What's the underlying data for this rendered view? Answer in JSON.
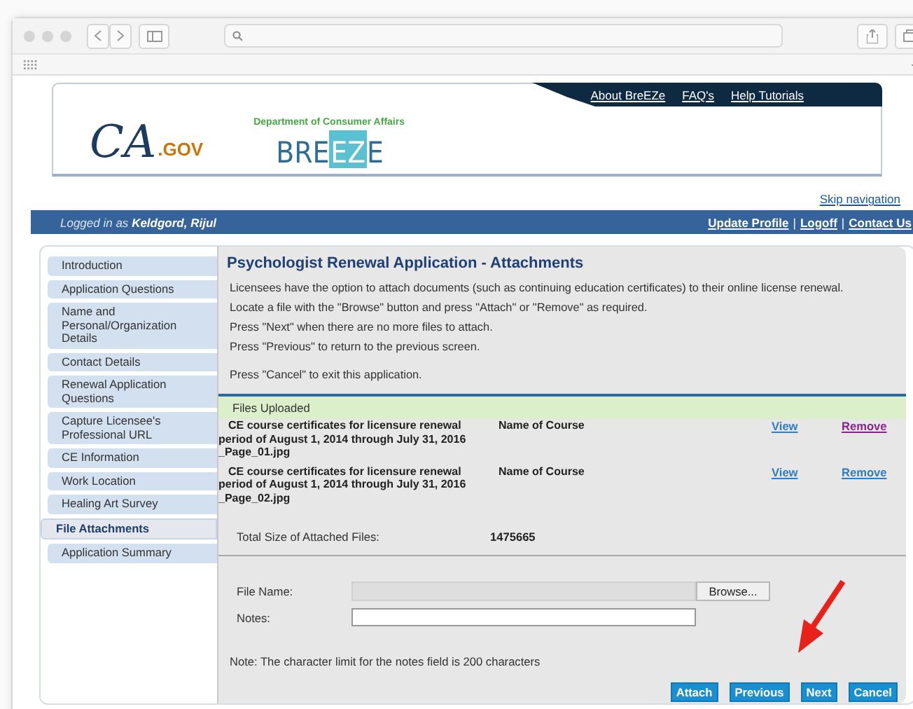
{
  "header": {
    "logo_ca": "CA",
    "logo_gov": ".GOV",
    "department": "Department of Consumer Affairs",
    "breeze": [
      "BRE",
      "EZ",
      "E"
    ],
    "top_links": [
      "About BreEZe",
      "FAQ's",
      "Help Tutorials"
    ]
  },
  "skip_link": "Skip navigation",
  "user_bar": {
    "prefix": "Logged in as",
    "user": "Keldgord, Rijul",
    "links": [
      "Update Profile",
      "Logoff",
      "Contact Us"
    ],
    "separator": "|"
  },
  "sidebar": {
    "items": [
      {
        "label": "Introduction",
        "selected": false
      },
      {
        "label": "Application Questions",
        "selected": false
      },
      {
        "label": "Name and Personal/Organization Details",
        "selected": false
      },
      {
        "label": "Contact Details",
        "selected": false
      },
      {
        "label": "Renewal Application Questions",
        "selected": false
      },
      {
        "label": "Capture Licensee's Professional URL",
        "selected": false
      },
      {
        "label": "CE Information",
        "selected": false
      },
      {
        "label": "Work Location",
        "selected": false
      },
      {
        "label": "Healing Art Survey",
        "selected": false
      },
      {
        "label": "File Attachments",
        "selected": true
      },
      {
        "label": "Application Summary",
        "selected": false
      }
    ]
  },
  "content": {
    "title": "Psychologist Renewal Application - Attachments",
    "instructions": [
      "Licensees have the option to attach documents (such as continuing education certificates) to their online license renewal.",
      "Locate a file with the \"Browse\" button and press \"Attach\" or \"Remove\" as required.",
      "Press \"Next\" when there are no more files to attach.",
      "Press \"Previous\" to return to the previous screen.",
      "Press \"Cancel\" to exit this application."
    ],
    "files_heading": "Files Uploaded",
    "files": [
      {
        "name": "CE course certificates for licensure renewal period of August 1, 2014 through July 31, 2016 _Page_01.jpg",
        "course": "Name of Course",
        "view": "View",
        "remove": "Remove",
        "remove_visited": true
      },
      {
        "name": "CE course certificates for licensure renewal period of August 1, 2014 through July 31, 2016 _Page_02.jpg",
        "course": "Name of Course",
        "view": "View",
        "remove": "Remove",
        "remove_visited": false
      }
    ],
    "total_label": "Total Size of Attached Files:",
    "total_value": "1475665",
    "file_name_label": "File Name:",
    "browse": "Browse...",
    "notes_label": "Notes:",
    "note": "Note: The character limit for the notes field is 200 characters",
    "buttons": [
      "Attach",
      "Previous",
      "Next",
      "Cancel"
    ]
  }
}
